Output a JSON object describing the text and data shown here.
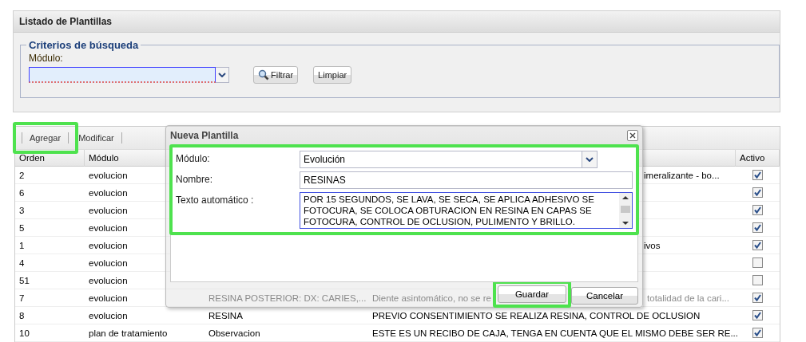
{
  "panel": {
    "title": "Listado de Plantillas",
    "legend": "Criterios de búsqueda",
    "field": {
      "label": "Módulo:",
      "invalid": true
    },
    "buttons": [
      {
        "label": "Filtrar",
        "kind": "search"
      },
      {
        "label": "Limpiar",
        "kind": "plain"
      }
    ]
  },
  "grid": {
    "toolbar": [
      {
        "label": "Agregar",
        "highlighted": true
      },
      {
        "label": "Modificar",
        "highlighted": false
      }
    ],
    "columns": [
      {
        "label": "Orden"
      },
      {
        "label": "Módulo"
      },
      {
        "label": "Activo"
      }
    ],
    "rows": [
      {
        "orden": "2",
        "modulo": "evolucion",
        "column_4": "imeralizante - bo...",
        "column_4_partly_hidden": true,
        "active": true
      },
      {
        "orden": "6",
        "modulo": "evolucion",
        "active": true
      },
      {
        "orden": "3",
        "modulo": "evolucion",
        "active": true
      },
      {
        "orden": "5",
        "modulo": "evolucion",
        "active": true
      },
      {
        "orden": "1",
        "modulo": "evolucion",
        "column_4": "ivos",
        "column_4_partly_hidden": true,
        "active": true
      },
      {
        "orden": "4",
        "modulo": "evolucion",
        "active": false
      },
      {
        "orden": "51",
        "modulo": "evolucion",
        "active": false
      },
      {
        "orden": "7",
        "modulo": "evolucion",
        "column_3": "RESINA POSTERIOR: DX: CARIES,...",
        "column_4_parts": [
          "Diente asintomático, no se re",
          "totalidad de la cari..."
        ],
        "active": true
      },
      {
        "orden": "8",
        "modulo": "evolucion",
        "column_3": "RESINA",
        "column_4": "PREVIO CONSENTIMIENTO SE REALIZA RESINA, CONTROL DE OCLUSION",
        "active": true
      },
      {
        "orden": "10",
        "modulo": "plan de tratamiento",
        "column_3": "Observacion",
        "column_4": "ESTE ES UN RECIBO DE CAJA, TENGA EN CUENTA QUE EL MISMO DEBE SER RE...",
        "active": true
      }
    ]
  },
  "dialog": {
    "title": "Nueva Plantilla",
    "highlighted": true,
    "fields": [
      {
        "kind": "select",
        "label": "Módulo:",
        "value": "Evolución"
      },
      {
        "kind": "text",
        "label": "Nombre:",
        "value": "RESINAS"
      },
      {
        "kind": "textarea",
        "label": "Texto automático :",
        "value": "POR 15 SEGUNDOS, SE LAVA, SE SECA, SE APLICA ADHESIVO SE FOTOCURA, SE COLOCA OBTURACION EN RESINA EN CAPAS SE FOTOCURA, CONTROL DE OCLUSION, PULIMENTO Y BRILLO."
      }
    ],
    "buttons": [
      {
        "label": "Guardar",
        "highlighted": true
      },
      {
        "label": "Cancelar",
        "highlighted": false
      }
    ]
  }
}
